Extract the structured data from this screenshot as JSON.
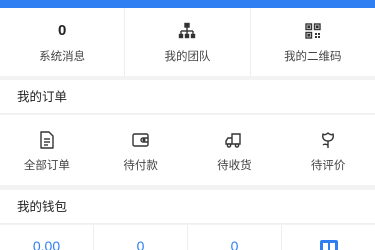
{
  "colors": {
    "accent": "#2f7ff3",
    "background": "#f3f3f3"
  },
  "stats": {
    "messages_count": "0",
    "messages_label": "系统消息",
    "team_label": "我的团队",
    "qrcode_label": "我的二维码"
  },
  "orders": {
    "title": "我的订单",
    "items": [
      {
        "label": "全部订单",
        "icon": "document-icon"
      },
      {
        "label": "待付款",
        "icon": "wallet-icon"
      },
      {
        "label": "待收货",
        "icon": "truck-icon"
      },
      {
        "label": "待评价",
        "icon": "flower-icon"
      }
    ]
  },
  "wallet": {
    "title": "我的钱包",
    "values": [
      "0.00",
      "0",
      "0"
    ],
    "last_icon": "wallet-card-icon"
  }
}
